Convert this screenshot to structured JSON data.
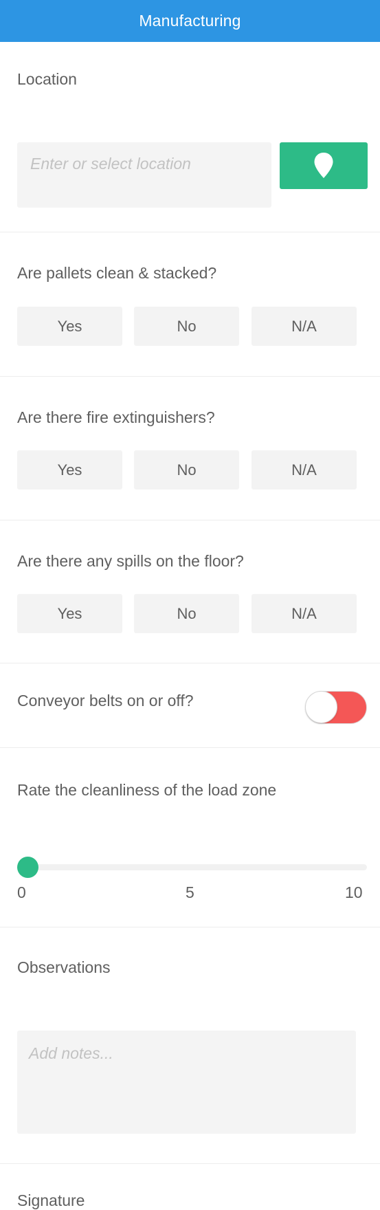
{
  "header": {
    "title": "Manufacturing"
  },
  "location": {
    "label": "Location",
    "placeholder": "Enter or select location",
    "button_icon": "map-pin-icon"
  },
  "questions": [
    {
      "label": "Are pallets clean & stacked?",
      "options": [
        "Yes",
        "No",
        "N/A"
      ]
    },
    {
      "label": "Are there fire extinguishers?",
      "options": [
        "Yes",
        "No",
        "N/A"
      ]
    },
    {
      "label": "Are there any spills on the floor?",
      "options": [
        "Yes",
        "No",
        "N/A"
      ]
    }
  ],
  "conveyor": {
    "label": "Conveyor belts on or off?",
    "state": "off",
    "off_color": "#f45756"
  },
  "rating": {
    "label": "Rate the cleanliness of the load zone",
    "min_label": "0",
    "mid_label": "5",
    "max_label": "10",
    "value": 0,
    "thumb_color": "#2dbb87"
  },
  "observations": {
    "label": "Observations",
    "placeholder": "Add notes..."
  },
  "signature": {
    "label": "Signature"
  },
  "colors": {
    "header": "#2d95e3",
    "accent": "#2dbb87"
  }
}
